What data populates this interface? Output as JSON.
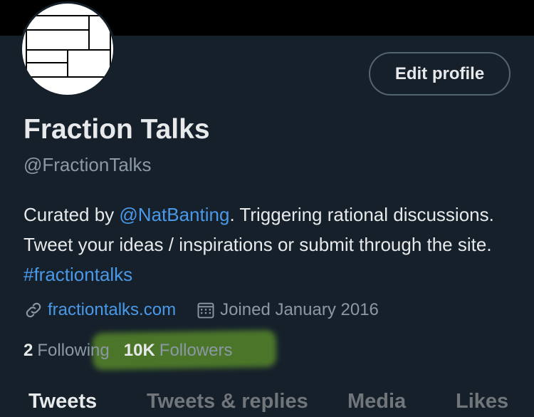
{
  "profile": {
    "name": "Fraction Talks",
    "handle": "@FractionTalks",
    "edit_button": "Edit profile",
    "bio": {
      "part1": "Curated by ",
      "mention": "@NatBanting",
      "part2": ". Triggering rational discussions. Tweet your ideas / inspirations or submit through the site. ",
      "hashtag": "#fractiontalks"
    },
    "website": "fractiontalks.com",
    "joined": "Joined January 2016",
    "following_count": "2",
    "following_label": "Following",
    "followers_count": "10K",
    "followers_label": "Followers"
  },
  "tabs": [
    {
      "label": "Tweets",
      "active": true
    },
    {
      "label": "Tweets & replies",
      "active": false
    },
    {
      "label": "Media",
      "active": false
    },
    {
      "label": "Likes",
      "active": false
    }
  ],
  "icons": {
    "website": "link-icon",
    "joined": "calendar-icon"
  },
  "colors": {
    "background": "#15202b",
    "text": "#e7e9ea",
    "secondary": "#8b98a5",
    "link": "#4a99e9",
    "highlight": "#78be28"
  }
}
